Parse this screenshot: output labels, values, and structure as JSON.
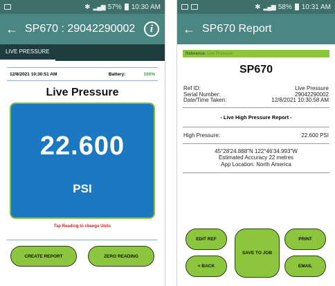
{
  "screen1": {
    "status": {
      "battery": "57%",
      "time": "10:30 AM"
    },
    "appbar": {
      "title": "SP670 : 29042290002"
    },
    "tab": {
      "label": "LIVE PRESSURE"
    },
    "info_row": {
      "datetime": "12/8/2021 10:30:51 AM",
      "battery_label": "Battery:",
      "battery_value": "100%"
    },
    "heading": "Live Pressure",
    "reading": {
      "value": "22.600",
      "unit": "PSI"
    },
    "hint": "Tap Reading to change Units",
    "buttons": {
      "create_report": "CREATE REPORT",
      "zero_reading": "ZERO READING"
    }
  },
  "screen2": {
    "status": {
      "battery": "58%",
      "time": "10:31 AM"
    },
    "appbar": {
      "title": "SP670 Report"
    },
    "reference": {
      "label": "Reference:",
      "value": "Live Pressure"
    },
    "title": "SP670",
    "fields": [
      {
        "label": "Ref ID:",
        "value": "Live Pressure"
      },
      {
        "label": "Serial Number:",
        "value": "29042290002"
      },
      {
        "label": "Date/Time Taken:",
        "value": "12/8/2021 10:30:58 AM"
      }
    ],
    "report_heading": "- Live High Pressure Report -",
    "high_pressure": {
      "label": "High Pressure:",
      "value": "22.600 PSI"
    },
    "location": {
      "coords": "45°28'24.888\"N 122°46'34.993\"W",
      "accuracy": "Estimated Accuracy 22 metres",
      "app_location": "App Location: North America"
    },
    "buttons": {
      "edit_ref": "EDIT REF",
      "save_to_job": "SAVE TO JOB",
      "print": "PRINT",
      "back": "< BACK",
      "email": "EMAIL"
    }
  },
  "colors": {
    "appbar": "#4b8782",
    "statusbar": "#3f6f6b",
    "tabbar": "#1e3b3d",
    "reading_bg": "#1d78c2",
    "accent_green": "#8cc63f",
    "hint_red": "#e21e1e"
  },
  "icons": {
    "back": "arrow-left-icon",
    "info": "info-icon"
  }
}
